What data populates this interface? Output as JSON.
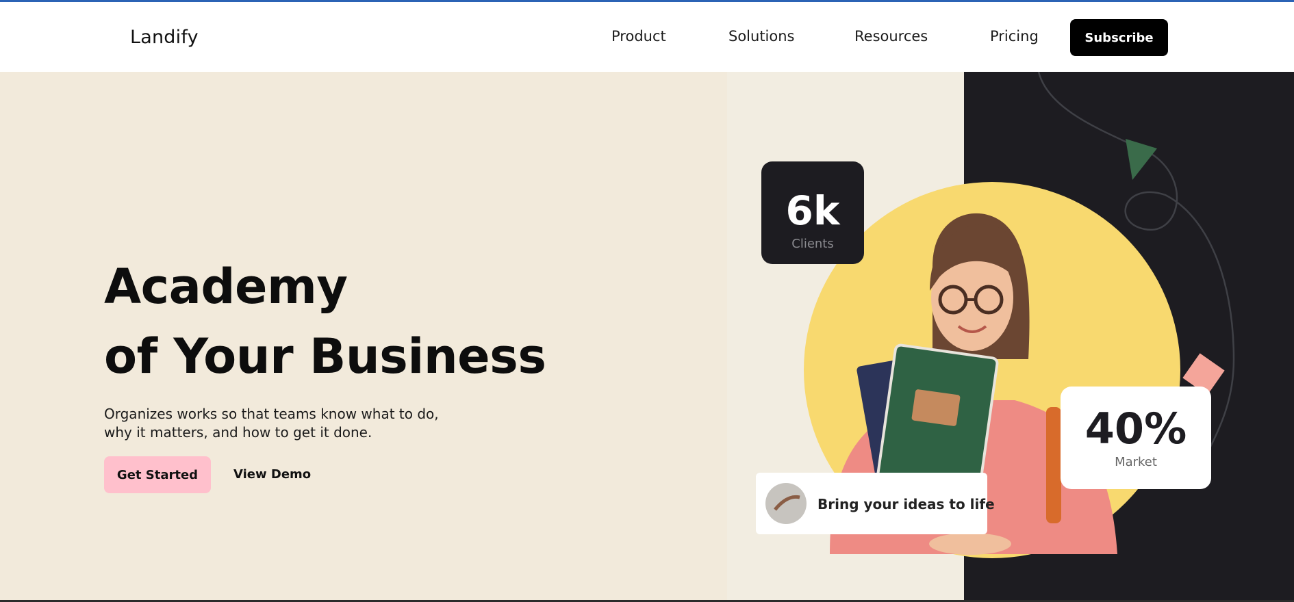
{
  "header": {
    "logo": "Landify",
    "nav": {
      "product": "Product",
      "solutions": "Solutions",
      "resources": "Resources",
      "pricing": "Pricing"
    },
    "subscribe_label": "Subscribe"
  },
  "hero": {
    "title_line1": "Academy",
    "title_line2": "of Your Business",
    "subtitle_line1": "Organizes works so that teams know what to do,",
    "subtitle_line2": "why it matters, and how to get it done.",
    "primary_cta": "Get Started",
    "secondary_cta": "View Demo"
  },
  "hero_image": {
    "stat_clients_value": "6k",
    "stat_clients_label": "Clients",
    "stat_market_value": "40%",
    "stat_market_label": "Market",
    "badge_text": "Bring your ideas to life"
  },
  "colors": {
    "accent_pink": "#ffc0cc",
    "hero_bg": "#f2eadb",
    "dark": "#1d1c21",
    "yellow_circle": "#f8d96f",
    "top_bar": "#2b63b5"
  }
}
